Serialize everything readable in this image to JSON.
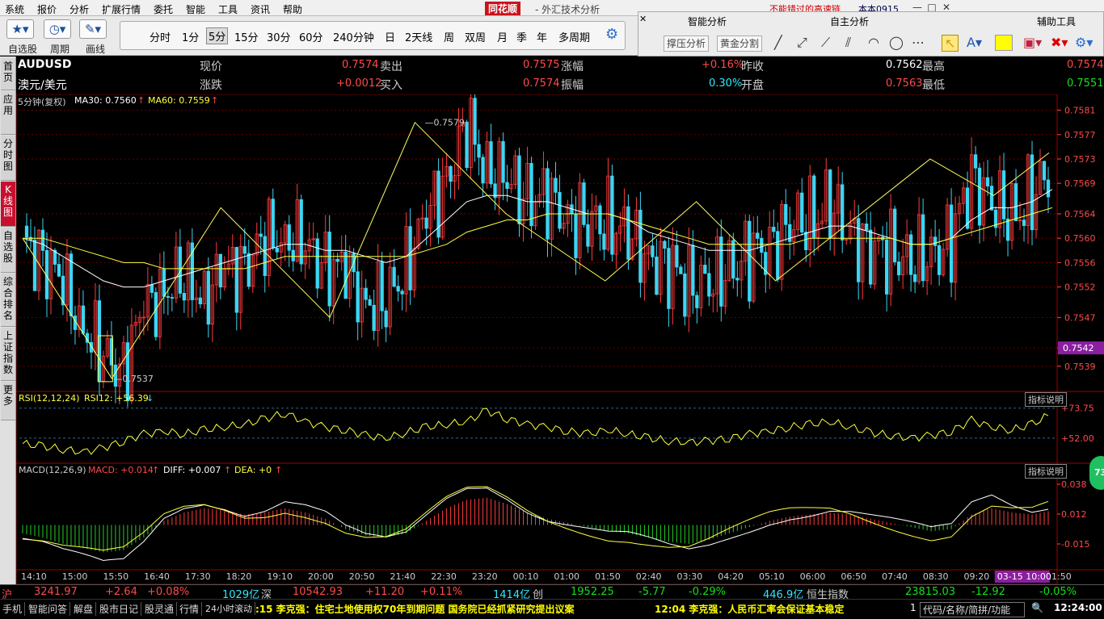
{
  "menu": [
    "系统",
    "报价",
    "分析",
    "扩展行情",
    "委托",
    "智能",
    "工具",
    "资讯",
    "帮助"
  ],
  "brand": "同花顺",
  "app_title": "- 外汇技术分析",
  "ad_text": "不能错过的高速链",
  "account": "本本0915",
  "window_buttons": {
    "info": "资讯",
    "trade": "委托"
  },
  "toolbar": {
    "watchlist": "自选股",
    "cycle": "周期",
    "draw": "画线"
  },
  "periods": [
    "分时",
    "1分",
    "5分",
    "15分",
    "30分",
    "60分",
    "240分钟",
    "日",
    "2天线",
    "周",
    "双周",
    "月",
    "季",
    "年",
    "多周期"
  ],
  "period_selected": "5分",
  "right_panel": {
    "smart": "智能分析",
    "self": "自主分析",
    "aux": "辅助工具",
    "support_btn": "撑压分析",
    "golden_btn": "黄金分割"
  },
  "side_tabs": [
    "首页",
    "应用",
    "分时图",
    "K线图",
    "自选股",
    "综合排名",
    "上证指数",
    "更多"
  ],
  "side_active": "K线图",
  "quote": {
    "symbol": "AUDUSD",
    "name": "澳元/美元",
    "price_lbl": "现价",
    "price": "0.7574",
    "change_lbl": "涨跌",
    "change": "+0.0012",
    "sell_lbl": "卖出",
    "sell": "0.7575",
    "buy_lbl": "买入",
    "buy": "0.7574",
    "pct_lbl": "涨幅",
    "pct": "+0.16%",
    "amp_lbl": "振幅",
    "amp": "0.30%",
    "prev_lbl": "昨收",
    "prev": "0.7562",
    "open_lbl": "开盘",
    "open": "0.7563",
    "high_lbl": "最高",
    "high": "0.7574",
    "low_lbl": "最低",
    "low": "0.7551"
  },
  "kline_header": {
    "period": "5分钟(复权)",
    "ma30": "MA30: 0.7560",
    "ma60": "MA60: 0.7559"
  },
  "rsi_header": {
    "name": "RSI(12,12,24)",
    "value": "RSI12: +56.39"
  },
  "macd_header": {
    "name": "MACD(12,26,9)",
    "macd": "MACD: +0.014",
    "diff": "DIFF: +0.007",
    "dea": "DEA: +0"
  },
  "indicator_btn": "指标说明",
  "chart_data": {
    "type": "candlestick",
    "price_axis": [
      "0.7581",
      "0.7577",
      "0.7573",
      "0.7569",
      "0.7564",
      "0.7560",
      "0.7556",
      "0.7552",
      "0.7547",
      "0.7542",
      "0.7539"
    ],
    "current_price_tag": "0.7542",
    "ylim": [
      0.7535,
      0.7582
    ],
    "peak_label": "0.7579",
    "trough_label": "0.7537",
    "rsi_axis": [
      "+73.75",
      "+52.00"
    ],
    "macd_axis": [
      "0.038",
      "0.012",
      "-0.015"
    ],
    "time_axis": [
      "14:10",
      "15:00",
      "15:50",
      "16:40",
      "17:30",
      "18:20",
      "19:10",
      "20:00",
      "20:50",
      "21:40",
      "22:30",
      "23:20",
      "00:10",
      "01:00",
      "01:50",
      "02:40",
      "03:30",
      "04:20",
      "05:10",
      "06:00",
      "06:50",
      "07:40",
      "08:30",
      "09:20",
      "10:00",
      "11:50"
    ],
    "time_cursor": "03-15 10:00",
    "close_path": [
      0.7559,
      0.7557,
      0.7552,
      0.7546,
      0.754,
      0.7539,
      0.7548,
      0.7552,
      0.7553,
      0.7551,
      0.7554,
      0.7556,
      0.7559,
      0.7561,
      0.7558,
      0.7556,
      0.7554,
      0.755,
      0.7549,
      0.7556,
      0.7563,
      0.757,
      0.7578,
      0.7572,
      0.7569,
      0.7567,
      0.7566,
      0.7564,
      0.7562,
      0.7563,
      0.756,
      0.7557,
      0.7555,
      0.7553,
      0.7552,
      0.7555,
      0.7557,
      0.7559,
      0.7562,
      0.7563,
      0.7565,
      0.7561,
      0.7558,
      0.7558,
      0.7556,
      0.7557,
      0.756,
      0.757,
      0.7566,
      0.7563,
      0.7567,
      0.7571
    ],
    "ma30_path": [
      0.756,
      0.7559,
      0.7557,
      0.7555,
      0.7553,
      0.7552,
      0.7552,
      0.7553,
      0.7554,
      0.7555,
      0.7556,
      0.7557,
      0.7558,
      0.7559,
      0.7559,
      0.7558,
      0.7558,
      0.7557,
      0.7556,
      0.7557,
      0.756,
      0.7563,
      0.7566,
      0.7567,
      0.7567,
      0.7566,
      0.7566,
      0.7565,
      0.7564,
      0.7564,
      0.7563,
      0.7561,
      0.756,
      0.7559,
      0.7558,
      0.7558,
      0.7558,
      0.7559,
      0.756,
      0.7561,
      0.7562,
      0.7562,
      0.7561,
      0.756,
      0.7559,
      0.7559,
      0.756,
      0.7563,
      0.7565,
      0.7565,
      0.7566,
      0.7568
    ],
    "ma60_path": [
      0.756,
      0.756,
      0.7559,
      0.7558,
      0.7557,
      0.7556,
      0.7556,
      0.7555,
      0.7555,
      0.7555,
      0.7555,
      0.7555,
      0.7556,
      0.7557,
      0.7557,
      0.7557,
      0.7557,
      0.7557,
      0.7557,
      0.7557,
      0.7558,
      0.7559,
      0.7561,
      0.7562,
      0.7563,
      0.7563,
      0.7564,
      0.7564,
      0.7564,
      0.7564,
      0.7563,
      0.7562,
      0.7561,
      0.756,
      0.7559,
      0.7559,
      0.7559,
      0.7559,
      0.7559,
      0.756,
      0.756,
      0.756,
      0.756,
      0.756,
      0.7559,
      0.7559,
      0.756,
      0.7561,
      0.7562,
      0.7563,
      0.7564,
      0.7565
    ],
    "zigzag": [
      0.756,
      0.7537,
      0.7565,
      0.7547,
      0.7579,
      0.7564,
      0.7553,
      0.7566,
      0.7553,
      0.7573,
      0.7567,
      0.7574
    ],
    "rsi_path": [
      48,
      46,
      44,
      42,
      45,
      50,
      55,
      57,
      55,
      58,
      60,
      62,
      66,
      70,
      64,
      60,
      58,
      54,
      52,
      56,
      60,
      62,
      64,
      72,
      66,
      62,
      60,
      57,
      55,
      58,
      55,
      52,
      50,
      49,
      50,
      52,
      55,
      57,
      60,
      62,
      64,
      60,
      56,
      54,
      52,
      54,
      57,
      65,
      60,
      58,
      62,
      70
    ],
    "macd_bars": [
      -4,
      -6,
      -9,
      -11,
      -13,
      -12,
      -6,
      2,
      6,
      8,
      7,
      5,
      6,
      8,
      6,
      3,
      -2,
      -5,
      -6,
      -4,
      2,
      8,
      12,
      13,
      10,
      6,
      3,
      1,
      -1,
      -3,
      -4,
      -6,
      -8,
      -9,
      -7,
      -4,
      -1,
      2,
      4,
      5,
      6,
      5,
      3,
      1,
      -1,
      -3,
      -2,
      5,
      8,
      6,
      5,
      7
    ]
  },
  "status_bar": {
    "sh_lbl": "沪",
    "sh_idx": "3241.97",
    "sh_chg": "+2.64",
    "sh_pct": "+0.08%",
    "sh_amt": "1029亿",
    "sz_lbl": "深",
    "sz_idx": "10542.93",
    "sz_chg": "+11.20",
    "sz_pct": "+0.11%",
    "sz_amt": "1414亿",
    "cy_lbl": "创",
    "cy_idx": "1952.25",
    "cy_chg": "-5.77",
    "cy_pct": "-0.29%",
    "cy_amt": "446.9亿",
    "hs_lbl": "恒生指数",
    "hs_idx": "23815.03",
    "hs_chg": "-12.92",
    "hs_pct": "-0.05%"
  },
  "bottom_bar": {
    "tabs": [
      "手机",
      "智能问答",
      "解盘",
      "股市日记",
      "股灵通",
      "行情",
      "24小时滚动"
    ],
    "news1": ":15 李克强：住宅土地使用权70年到期问题 国务院已经抓紧研究提出议案",
    "news2": "12:04 李克强：人民币汇率会保证基本稳定",
    "search_placeholder": "代码/名称/简拼/功能",
    "clock": "12:24:00",
    "float_badge": "73"
  },
  "colors": {
    "up": "#ff3b3b",
    "down": "#3bd6f4",
    "ma30": "#ffffff",
    "ma60": "#ffff40",
    "zigzag": "#ffff60",
    "grid": "#6a0000"
  }
}
